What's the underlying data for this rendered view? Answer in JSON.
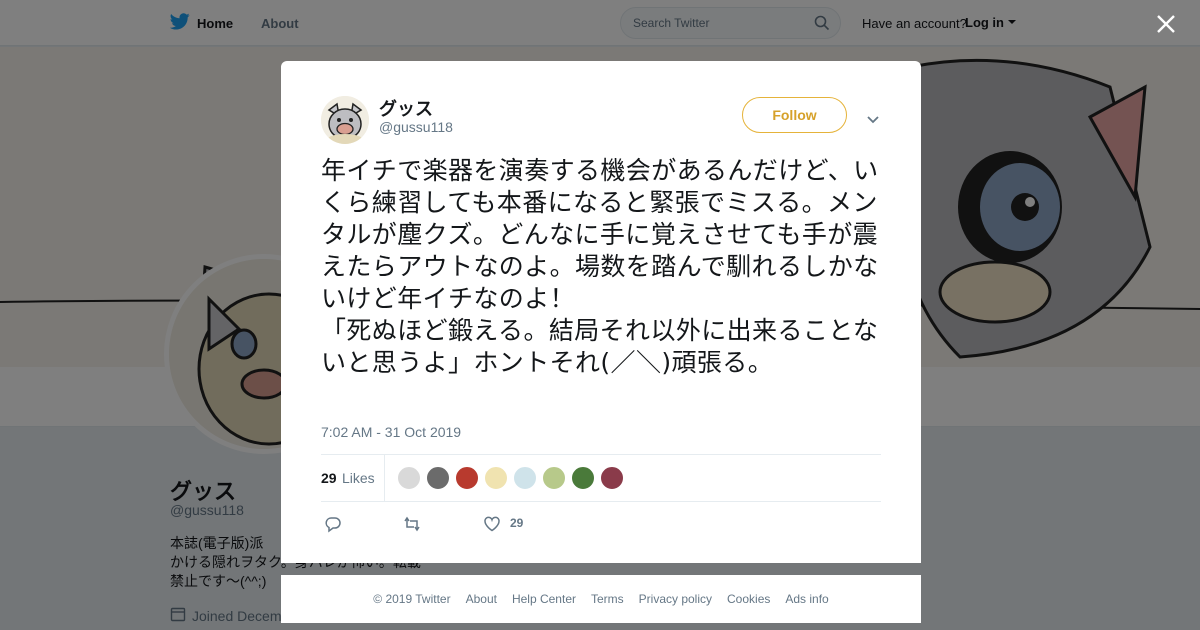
{
  "topbar": {
    "home_label": "Home",
    "about_label": "About",
    "search_placeholder": "Search Twitter",
    "have_account": "Have an account?",
    "login_label": "Log in"
  },
  "profile": {
    "name": "グッス",
    "handle": "@gussu118",
    "bio_line1": "本誌(電子版)派",
    "bio_line2": "かける隠れヲタク。身バレが怖い。転載",
    "bio_line3": "禁止です～(^^;)",
    "joined": "Joined Decem"
  },
  "tweet": {
    "author_name": "グッス",
    "author_handle": "@gussu118",
    "follow_label": "Follow",
    "text": "年イチで楽器を演奏する機会があるんだけど、いくら練習しても本番になると緊張でミスる。メンタルが塵クズ。どんなに手に覚えさせても手が震えたらアウトなのよ。場数を踏んで馴れるしかないけど年イチなのよ！\n「死ぬほど鍛える。結局それ以外に出来ることないと思うよ」ホントそれ(／＼)頑張る。",
    "timestamp": "7:02 AM - 31 Oct 2019",
    "likes_count": "29",
    "likes_label": "Likes",
    "like_action_count": "29",
    "liker_avatar_colors": [
      "#d9d9d9",
      "#6b6b6b",
      "#b83a2e",
      "#f0e3b0",
      "#cfe3ea",
      "#b7c98a",
      "#4a7a3a",
      "#8a3b4a"
    ]
  },
  "icons": {
    "brand": "twitter-bird-icon",
    "close": "close-icon",
    "reply": "reply-icon",
    "retweet": "retweet-icon",
    "like": "heart-icon",
    "more": "chevron-down-icon",
    "calendar": "calendar-icon"
  },
  "footer": {
    "copyright": "© 2019 Twitter",
    "about": "About",
    "help": "Help Center",
    "terms": "Terms",
    "privacy": "Privacy policy",
    "cookies": "Cookies",
    "ads": "Ads info"
  },
  "colors": {
    "twitter_blue": "#1da1f2",
    "follow_accent": "#e5b33a",
    "muted_text": "#657786"
  }
}
